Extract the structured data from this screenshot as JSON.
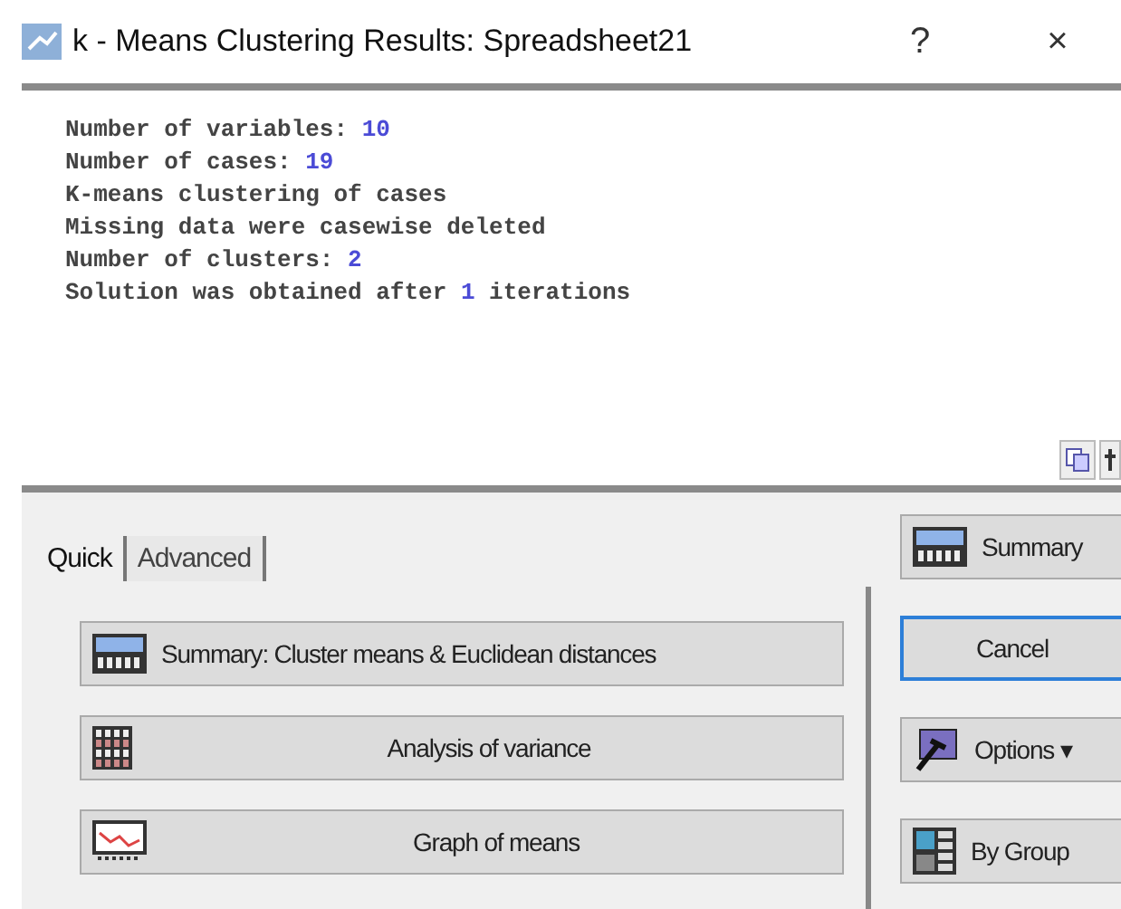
{
  "window": {
    "title": "k - Means Clustering Results: Spreadsheet21",
    "help": "?",
    "close": "×"
  },
  "output": [
    {
      "prefix": "Number of variables: ",
      "value": "10"
    },
    {
      "prefix": "Number of cases: ",
      "value": "19"
    },
    {
      "prefix": "K-means clustering of cases"
    },
    {
      "prefix": "Missing data were casewise deleted"
    },
    {
      "prefix": "Number of clusters: ",
      "value": "2"
    },
    {
      "prefix": "Solution was obtained after ",
      "value": "1",
      "suffix": " iterations"
    }
  ],
  "tabs": [
    {
      "label": "Quick",
      "selected": true
    },
    {
      "label": "Advanced",
      "selected": false
    }
  ],
  "actions": [
    {
      "label": "Summary: Cluster means & Euclidean distances",
      "kind": "table"
    },
    {
      "label": "Analysis of variance",
      "kind": "grid"
    },
    {
      "label": "Graph of means",
      "kind": "graph"
    }
  ],
  "side_buttons": [
    {
      "label": "Summary",
      "kind": "table",
      "focused": false
    },
    {
      "label": "Cancel",
      "kind": "none",
      "focused": true
    },
    {
      "label": "Options ▾",
      "kind": "options",
      "focused": false
    },
    {
      "label": "By Group",
      "kind": "group",
      "focused": false
    }
  ]
}
